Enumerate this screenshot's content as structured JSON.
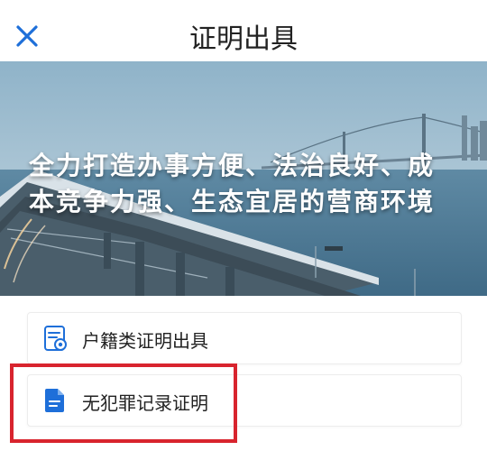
{
  "header": {
    "title": "证明出具"
  },
  "banner": {
    "line1": "全力打造办事方便、法治良好、成",
    "line2": "本竞争力强、生态宜居的营商环境"
  },
  "services": [
    {
      "label": "户籍类证明出具",
      "icon": "document-stamp-icon"
    },
    {
      "label": "无犯罪记录证明",
      "icon": "file-icon"
    }
  ],
  "colors": {
    "accent": "#1e6fd9",
    "highlight": "#d8242e"
  }
}
